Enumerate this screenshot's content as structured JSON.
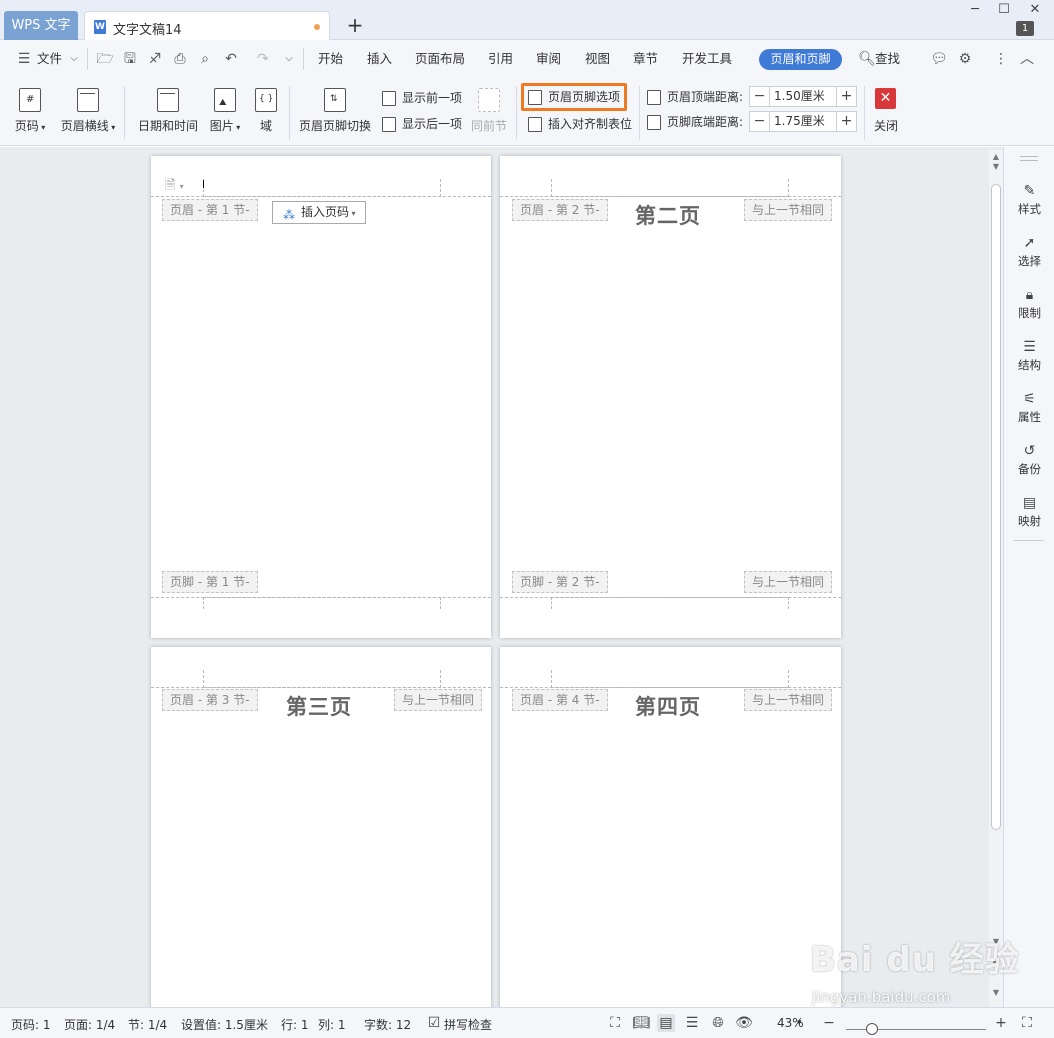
{
  "titlebar": {
    "app_tab": "WPS 文字",
    "doc_tab": "文字文稿14",
    "add_tab": "+",
    "win_min": "─",
    "win_max": "☐",
    "win_close": "✕",
    "page_badge": "1"
  },
  "menubar": {
    "file": "文件",
    "items": [
      "开始",
      "插入",
      "页面布局",
      "引用",
      "审阅",
      "视图",
      "章节",
      "开发工具"
    ],
    "active": "页眉和页脚",
    "search": "查找"
  },
  "ribbon": {
    "page_number": "页码",
    "header_line": "页眉横线",
    "datetime": "日期和时间",
    "picture": "图片",
    "field": "域",
    "switch": "页眉页脚切换",
    "show_prev": "显示前一项",
    "show_next": "显示后一项",
    "same_as_prev": "同前节",
    "options": "页眉页脚选项",
    "insert_align_tab": "插入对齐制表位",
    "header_top_label": "页眉顶端距离:",
    "header_top_value": "1.50厘米",
    "footer_bottom_label": "页脚底端距离:",
    "footer_bottom_value": "1.75厘米",
    "close": "关闭"
  },
  "pages": {
    "p1": {
      "header_tag": "页眉  - 第 1 节-",
      "footer_tag": "页脚  - 第 1 节-",
      "insert_page_number": "插入页码"
    },
    "p2": {
      "header_tag": "页眉  - 第 2 节-",
      "title": "第二页",
      "same_tag": "与上一节相同",
      "footer_tag": "页脚  - 第 2 节-",
      "footer_same": "与上一节相同"
    },
    "p3": {
      "header_tag": "页眉  - 第 3 节-",
      "title": "第三页",
      "same_tag": "与上一节相同"
    },
    "p4": {
      "header_tag": "页眉  - 第 4 节-",
      "title": "第四页",
      "same_tag": "与上一节相同"
    }
  },
  "sidebar": [
    "样式",
    "选择",
    "限制",
    "结构",
    "属性",
    "备份",
    "映射"
  ],
  "statusbar": {
    "page_num": "页码: 1",
    "page": "页面: 1/4",
    "section": "节: 1/4",
    "setting": "设置值: 1.5厘米",
    "row": "行: 1",
    "col": "列: 1",
    "words": "字数: 12",
    "spell": "拼写检查",
    "zoom": "43%"
  },
  "watermark": {
    "logo": "Bai du 经验",
    "url": "jingyan.baidu.com"
  },
  "colors": {
    "accent": "#3e7ad6",
    "highlight": "#f07a22",
    "close": "#d9383a"
  }
}
